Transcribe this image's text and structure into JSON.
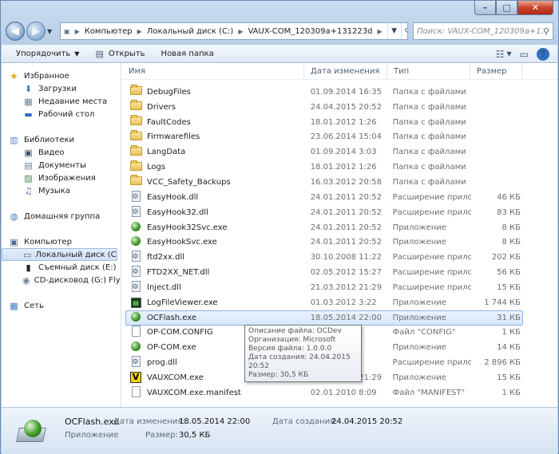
{
  "window": {
    "controls": {
      "minimize": "–",
      "maximize": "□",
      "close": "✕"
    }
  },
  "nav": {
    "back_icon": "back-arrow-icon",
    "forward_icon": "forward-arrow-icon",
    "breadcrumbs": [
      "Компьютер",
      "Локальный диск (C:)",
      "VAUX-COM_120309a+131223d"
    ],
    "search_placeholder": "Поиск: VAUX-COM_120309a+13..."
  },
  "toolbar": {
    "organize": "Упорядочить",
    "open": "Открыть",
    "new_folder": "Новая папка"
  },
  "sidebar": {
    "favorites": {
      "label": "Избранное",
      "items": [
        "Загрузки",
        "Недавние места",
        "Рабочий стол"
      ]
    },
    "libraries": {
      "label": "Библиотеки",
      "items": [
        "Видео",
        "Документы",
        "Изображения",
        "Музыка"
      ]
    },
    "homegroup": "Домашняя группа",
    "computer": {
      "label": "Компьютер",
      "items": [
        "Локальный диск (C:)",
        "Съемный диск (E:)",
        "CD-дисковод (G:) Fly_"
      ]
    },
    "network": "Сеть"
  },
  "columns": {
    "name": "Имя",
    "date": "Дата изменения",
    "type": "Тип",
    "size": "Размер"
  },
  "files": [
    {
      "name": "DebugFiles",
      "date": "01.09.2014 16:35",
      "type": "Папка с файлами",
      "size": "",
      "icon": "folder"
    },
    {
      "name": "Drivers",
      "date": "24.04.2015 20:52",
      "type": "Папка с файлами",
      "size": "",
      "icon": "folder"
    },
    {
      "name": "FaultCodes",
      "date": "18.01.2012 1:26",
      "type": "Папка с файлами",
      "size": "",
      "icon": "folder"
    },
    {
      "name": "Firmwarefiles",
      "date": "23.06.2014 15:04",
      "type": "Папка с файлами",
      "size": "",
      "icon": "folder"
    },
    {
      "name": "LangData",
      "date": "01.09.2014 3:03",
      "type": "Папка с файлами",
      "size": "",
      "icon": "folder"
    },
    {
      "name": "Logs",
      "date": "18.01.2012 1:26",
      "type": "Папка с файлами",
      "size": "",
      "icon": "folder"
    },
    {
      "name": "VCC_Safety_Backups",
      "date": "16.03.2012 20:58",
      "type": "Папка с файлами",
      "size": "",
      "icon": "folder"
    },
    {
      "name": "EasyHook.dll",
      "date": "24.01.2011 20:52",
      "type": "Расширение прило...",
      "size": "46 КБ",
      "icon": "gear"
    },
    {
      "name": "EasyHook32.dll",
      "date": "24.01.2011 20:52",
      "type": "Расширение прило...",
      "size": "83 КБ",
      "icon": "gear"
    },
    {
      "name": "EasyHook32Svc.exe",
      "date": "24.01.2011 20:52",
      "type": "Приложение",
      "size": "8 КБ",
      "icon": "ball"
    },
    {
      "name": "EasyHookSvc.exe",
      "date": "24.01.2011 20:52",
      "type": "Приложение",
      "size": "8 КБ",
      "icon": "ball"
    },
    {
      "name": "ftd2xx.dll",
      "date": "30.10.2008 11:22",
      "type": "Расширение прило...",
      "size": "202 КБ",
      "icon": "gear"
    },
    {
      "name": "FTD2XX_NET.dll",
      "date": "02.05.2012 15:27",
      "type": "Расширение прило...",
      "size": "56 КБ",
      "icon": "gear"
    },
    {
      "name": "Inject.dll",
      "date": "21.03.2012 21:29",
      "type": "Расширение прило...",
      "size": "15 КБ",
      "icon": "gear"
    },
    {
      "name": "LogFileViewer.exe",
      "date": "01.03.2012 3:22",
      "type": "Приложение",
      "size": "1 744 КБ",
      "icon": "log"
    },
    {
      "name": "OCFlash.exe",
      "date": "18.05.2014 22:00",
      "type": "Приложение",
      "size": "31 КБ",
      "icon": "ball",
      "selected": true
    },
    {
      "name": "OP-COM.CONFIG",
      "date": "",
      "type": "Файл \"CONFIG\"",
      "size": "1 КБ",
      "icon": "file"
    },
    {
      "name": "OP-COM.exe",
      "date": "",
      "type": "Приложение",
      "size": "14 КБ",
      "icon": "ball"
    },
    {
      "name": "prog.dll",
      "date": "",
      "type": "Расширение прило...",
      "size": "2 896 КБ",
      "icon": "gear"
    },
    {
      "name": "VAUXCOM.exe",
      "date": "21.03.2012 21:29",
      "type": "Приложение",
      "size": "15 КБ",
      "icon": "v"
    },
    {
      "name": "VAUXCOM.exe.manifest",
      "date": "02.01.2010 8:09",
      "type": "Файл \"MANIFEST\"",
      "size": "1 КБ",
      "icon": "file"
    }
  ],
  "tooltip": {
    "lines": [
      "Описание файла: OCDev",
      "Организация: Microsoft",
      "Версия файла: 1.0.0.0",
      "Дата создания: 24.04.2015 20:52",
      "Размер: 30,5 КБ"
    ]
  },
  "details": {
    "name": "OCFlash.exe",
    "kind": "Приложение",
    "modified_label": "Дата изменения:",
    "modified_value": "18.05.2014 22:00",
    "created_label": "Дата создания:",
    "created_value": "24.04.2015 20:52",
    "size_label": "Размер:",
    "size_value": "30,5 КБ"
  }
}
